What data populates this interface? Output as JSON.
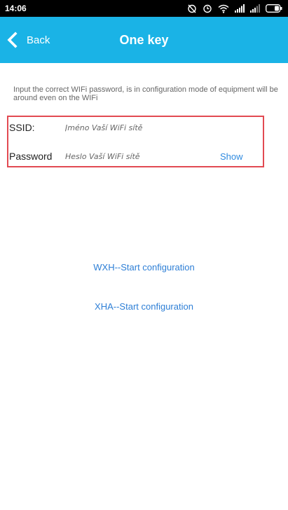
{
  "status_bar": {
    "time": "14:06",
    "icons": [
      "alarm-off-icon",
      "alarm-icon",
      "wifi-icon",
      "signal-icon",
      "signal-weak-icon",
      "battery-icon"
    ]
  },
  "app_bar": {
    "back_label": "Back",
    "title": "One key",
    "color": "#1ab3e6"
  },
  "hint_text": "Input the correct WIFi password, is in configuration mode of equipment will be around even on the WIFi",
  "form": {
    "ssid_label": "SSID:",
    "ssid_value": "",
    "ssid_placeholder": "Jméno Vaší WiFi sítě",
    "password_label": "Password",
    "password_value": "",
    "password_placeholder": "Heslo Vaší WiFi sítě",
    "show_label": "Show",
    "highlight_color": "#e24a52"
  },
  "actions": {
    "wxh_label": "WXH--Start configuration",
    "xha_label": "XHA--Start configuration"
  }
}
